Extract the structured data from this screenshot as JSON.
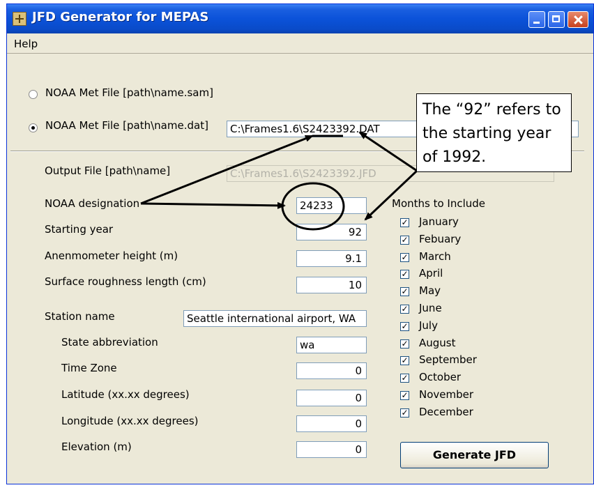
{
  "window": {
    "title": "JFD Generator for MEPAS"
  },
  "menu": {
    "help": "Help"
  },
  "input_options": {
    "sam_label": "NOAA Met File [path\\name.sam]",
    "sam_selected": false,
    "dat_label": "NOAA Met File [path\\name.dat]",
    "dat_selected": true,
    "dat_value": "C:\\Frames1.6\\S2423392.DAT"
  },
  "output": {
    "label": "Output File [path\\name]",
    "value": "C:\\Frames1.6\\S2423392.JFD"
  },
  "fields": {
    "noaa_designation": {
      "label": "NOAA designation",
      "value": "24233"
    },
    "starting_year": {
      "label": "Starting year",
      "value": "92"
    },
    "anemometer_height": {
      "label": "Anenmometer height (m)",
      "value": "9.1"
    },
    "surface_roughness": {
      "label": "Surface roughness length (cm)",
      "value": "10"
    },
    "station_name": {
      "label": "Station name",
      "value": "Seattle international airport, WA"
    },
    "state_abbreviation": {
      "label": "State abbreviation",
      "value": "wa"
    },
    "time_zone": {
      "label": "Time Zone",
      "value": "0"
    },
    "latitude": {
      "label": "Latitude (xx.xx degrees)",
      "value": "0"
    },
    "longitude": {
      "label": "Longitude (xx.xx degrees)",
      "value": "0"
    },
    "elevation": {
      "label": "Elevation (m)",
      "value": "0"
    }
  },
  "months": {
    "header": "Months to Include",
    "items": [
      {
        "label": "January",
        "checked": true
      },
      {
        "label": "Febuary",
        "checked": true
      },
      {
        "label": "March",
        "checked": true
      },
      {
        "label": "April",
        "checked": true
      },
      {
        "label": "May",
        "checked": true
      },
      {
        "label": "June",
        "checked": true
      },
      {
        "label": "July",
        "checked": true
      },
      {
        "label": "August",
        "checked": true
      },
      {
        "label": "September",
        "checked": true
      },
      {
        "label": "October",
        "checked": true
      },
      {
        "label": "November",
        "checked": true
      },
      {
        "label": "December",
        "checked": true
      }
    ]
  },
  "actions": {
    "generate": "Generate JFD"
  },
  "annotation": {
    "callout_text": "The “92” refers to the starting year of 1992."
  },
  "colors": {
    "titlebar": "#0b52d9",
    "window_bg": "#ece9d8",
    "annotation_stroke": "#000000"
  }
}
